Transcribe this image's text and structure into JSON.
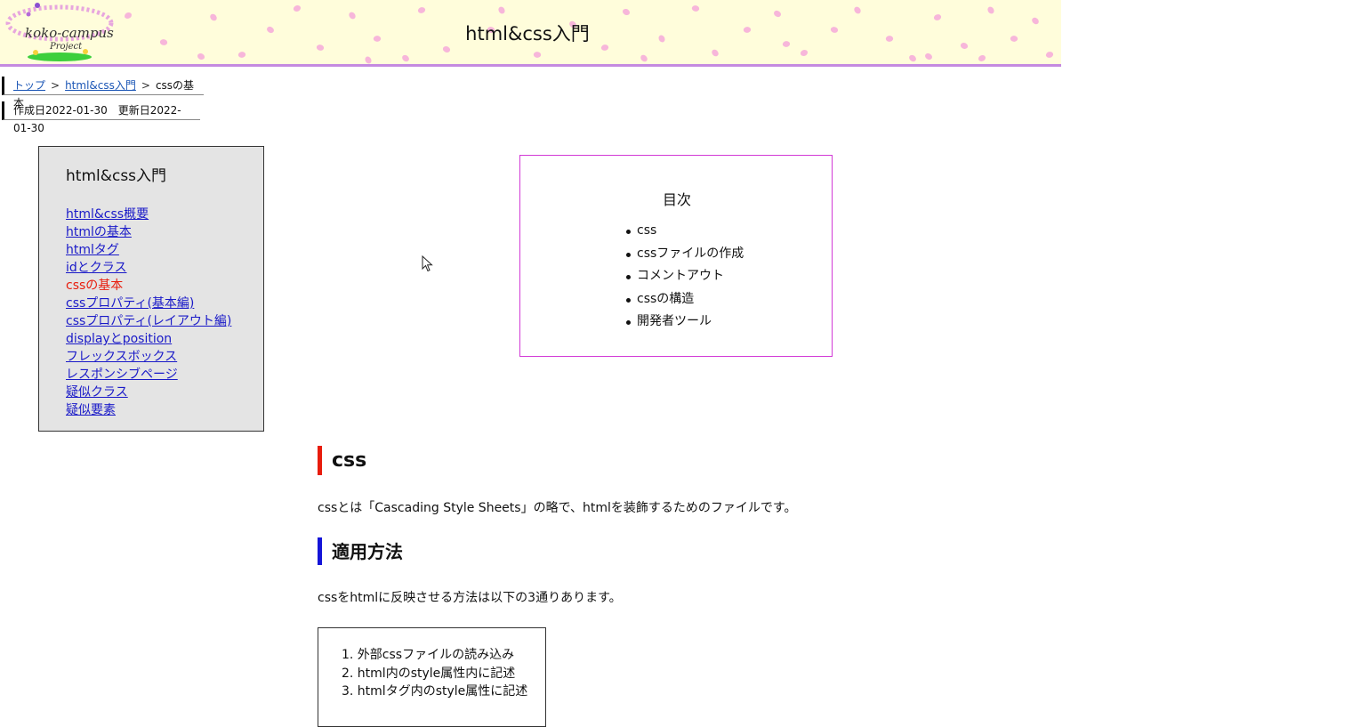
{
  "header": {
    "title": "html&css入門",
    "logo_text": "koko-campus",
    "logo_sub": "Project"
  },
  "breadcrumb": {
    "items": [
      "トップ",
      "html&css入門",
      "cssの基本"
    ],
    "separator": ">"
  },
  "dates": {
    "created": "作成日2022-01-30",
    "updated": "更新日2022-01-30"
  },
  "sidenav": {
    "title": "html&css入門",
    "items": [
      "html&css概要",
      "htmlの基本",
      "htmlタグ",
      "idとクラス",
      "cssの基本",
      "cssプロパティ(基本編)",
      "cssプロパティ(レイアウト編)",
      "displayとposition",
      "フレックスボックス",
      "レスポンシブページ",
      "疑似クラス",
      "疑似要素"
    ],
    "current_index": 4
  },
  "toc": {
    "title": "目次",
    "items": [
      "css",
      "cssファイルの作成",
      "コメントアウト",
      "cssの構造",
      "開発者ツール"
    ]
  },
  "content": {
    "h2": "css",
    "p1": "cssとは「Cascading Style Sheets」の略で、htmlを装飾するためのファイルです。",
    "h3": "適用方法",
    "p2": "cssをhtmlに反映させる方法は以下の3通りあります。",
    "methods": [
      "1. 外部cssファイルの読み込み",
      "2. html内のstyle属性内に記述",
      "3. htmlタグ内のstyle属性に記述"
    ]
  },
  "colors": {
    "header_bg": "#fffddb",
    "header_border": "#c48ae0",
    "current_nav": "#e81c0c",
    "toc_border": "#d23ad6",
    "h2_accent": "#e81c0c",
    "h3_accent": "#1414d8"
  }
}
